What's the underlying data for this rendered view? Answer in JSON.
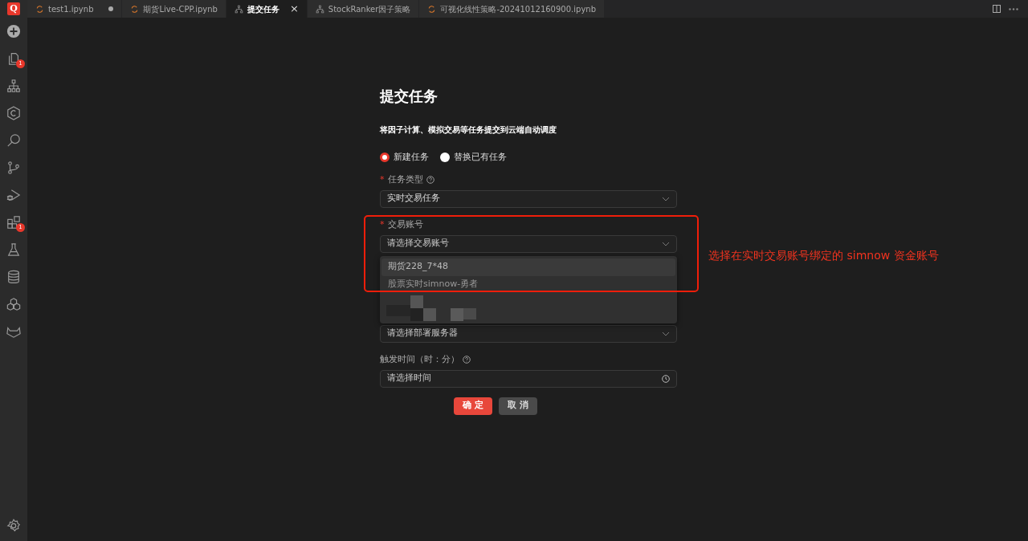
{
  "tabs": [
    {
      "label": "test1.ipynb",
      "kind": "notebook",
      "selected": false,
      "modified": true
    },
    {
      "label": "期货Live-CPP.ipynb",
      "kind": "notebook",
      "selected": false,
      "modified": false
    },
    {
      "label": "提交任务",
      "kind": "task",
      "selected": true,
      "modified": false,
      "close": "×"
    },
    {
      "label": "StockRanker因子策略",
      "kind": "task",
      "selected": false,
      "modified": false
    },
    {
      "label": "可视化线性策略-20241012160900.ipynb",
      "kind": "notebook",
      "selected": false,
      "modified": false
    }
  ],
  "logo": "Q",
  "sidebar": {
    "items": [
      {
        "kind": "add"
      },
      {
        "kind": "files",
        "badge": "1"
      },
      {
        "kind": "tree"
      },
      {
        "kind": "hex"
      },
      {
        "kind": "search"
      },
      {
        "kind": "branch"
      },
      {
        "kind": "debug"
      },
      {
        "kind": "extensions",
        "badge": "1"
      },
      {
        "kind": "flask"
      },
      {
        "kind": "database"
      },
      {
        "kind": "cluster"
      },
      {
        "kind": "fox"
      }
    ],
    "bottom": [
      {
        "kind": "settings"
      }
    ]
  },
  "form": {
    "title": "提交任务",
    "subtitle": "将因子计算、模拟交易等任务提交到云端自动调度",
    "modes": [
      {
        "label": "新建任务",
        "selected": true
      },
      {
        "label": "替换已有任务",
        "selected": false
      }
    ],
    "fields": [
      {
        "label": "任务类型",
        "required_mark": "*",
        "help": true,
        "value": "实时交易任务",
        "kind": "select"
      },
      {
        "label": "交易账号",
        "required_mark": "*",
        "help": false,
        "placeholder": "请选择交易账号",
        "kind": "select",
        "open": true,
        "options": [
          {
            "label": "期货228_7*48",
            "selected": true
          },
          {
            "label": "股票实时simnow-勇者",
            "selected": false
          }
        ]
      },
      {
        "placeholder": "请选择部署服务器",
        "kind": "select"
      },
      {
        "label": "触发时间（时：分）",
        "help": true,
        "placeholder": "请选择时间",
        "kind": "time"
      }
    ],
    "buttons": [
      {
        "label": "确 定",
        "kind": "primary"
      },
      {
        "label": "取 消",
        "kind": "secondary"
      }
    ]
  },
  "annotation": {
    "text": "选择在实时交易账号绑定的 simnow 资金账号"
  }
}
